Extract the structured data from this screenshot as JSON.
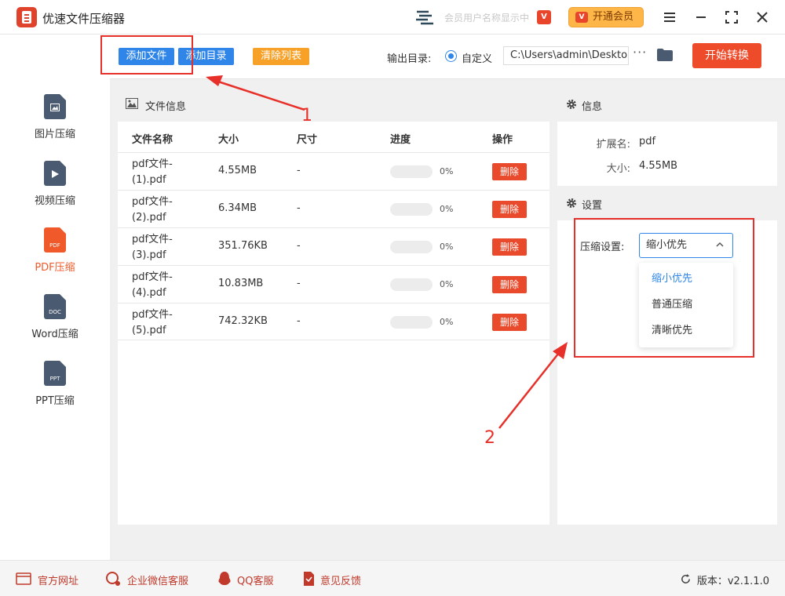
{
  "app": {
    "title": "优速文件压缩器",
    "user_name": "会员用户名称显示中"
  },
  "titlebar": {
    "vip_mini": "V",
    "vip_button": "开通会员"
  },
  "nav": {
    "items": [
      {
        "label": "图片压缩",
        "tag": "",
        "icon": "image-file-icon",
        "active": false
      },
      {
        "label": "视频压缩",
        "tag": "",
        "icon": "video-file-icon",
        "active": false
      },
      {
        "label": "PDF压缩",
        "tag": "PDF",
        "icon": "pdf-file-icon",
        "active": true
      },
      {
        "label": "Word压缩",
        "tag": "DOC",
        "icon": "doc-file-icon",
        "active": false
      },
      {
        "label": "PPT压缩",
        "tag": "PPT",
        "icon": "ppt-file-icon",
        "active": false
      }
    ]
  },
  "toolbar": {
    "add_file": "添加文件",
    "add_dir": "添加目录",
    "clear_list": "清除列表",
    "output_label": "输出目录:",
    "radio_label": "自定义",
    "output_path": "C:\\Users\\admin\\Desktop",
    "more": "···",
    "start": "开始转换"
  },
  "file_panel": {
    "title": "文件信息",
    "columns": [
      "文件名称",
      "大小",
      "尺寸",
      "进度",
      "操作"
    ],
    "rows": [
      {
        "name_line1": "pdf文件-",
        "name_line2": "(1).pdf",
        "size": "4.55MB",
        "dim": "-",
        "progress": "0%",
        "action": "删除"
      },
      {
        "name_line1": "pdf文件-",
        "name_line2": "(2).pdf",
        "size": "6.34MB",
        "dim": "-",
        "progress": "0%",
        "action": "删除"
      },
      {
        "name_line1": "pdf文件-",
        "name_line2": "(3).pdf",
        "size": "351.76KB",
        "dim": "-",
        "progress": "0%",
        "action": "删除"
      },
      {
        "name_line1": "pdf文件-",
        "name_line2": "(4).pdf",
        "size": "10.83MB",
        "dim": "-",
        "progress": "0%",
        "action": "删除"
      },
      {
        "name_line1": "pdf文件-",
        "name_line2": "(5).pdf",
        "size": "742.32KB",
        "dim": "-",
        "progress": "0%",
        "action": "删除"
      }
    ]
  },
  "info_panel": {
    "info_title": "信息",
    "ext_label": "扩展名:",
    "ext_value": "pdf",
    "size_label": "大小:",
    "size_value": "4.55MB",
    "settings_title": "设置",
    "compress_label": "压缩设置:",
    "compress_value": "缩小优先",
    "options": [
      "缩小优先",
      "普通压缩",
      "清晰优先"
    ]
  },
  "annotations": {
    "one": "1",
    "two": "2"
  },
  "footer": {
    "website": "官方网址",
    "wechat": "企业微信客服",
    "qq": "QQ客服",
    "feedback": "意见反馈",
    "version": "版本：v2.1.1.0"
  },
  "colors": {
    "accent": "#2f86e8",
    "danger": "#e84a2b",
    "orange": "#f7a128",
    "vip": "#ffb648"
  }
}
